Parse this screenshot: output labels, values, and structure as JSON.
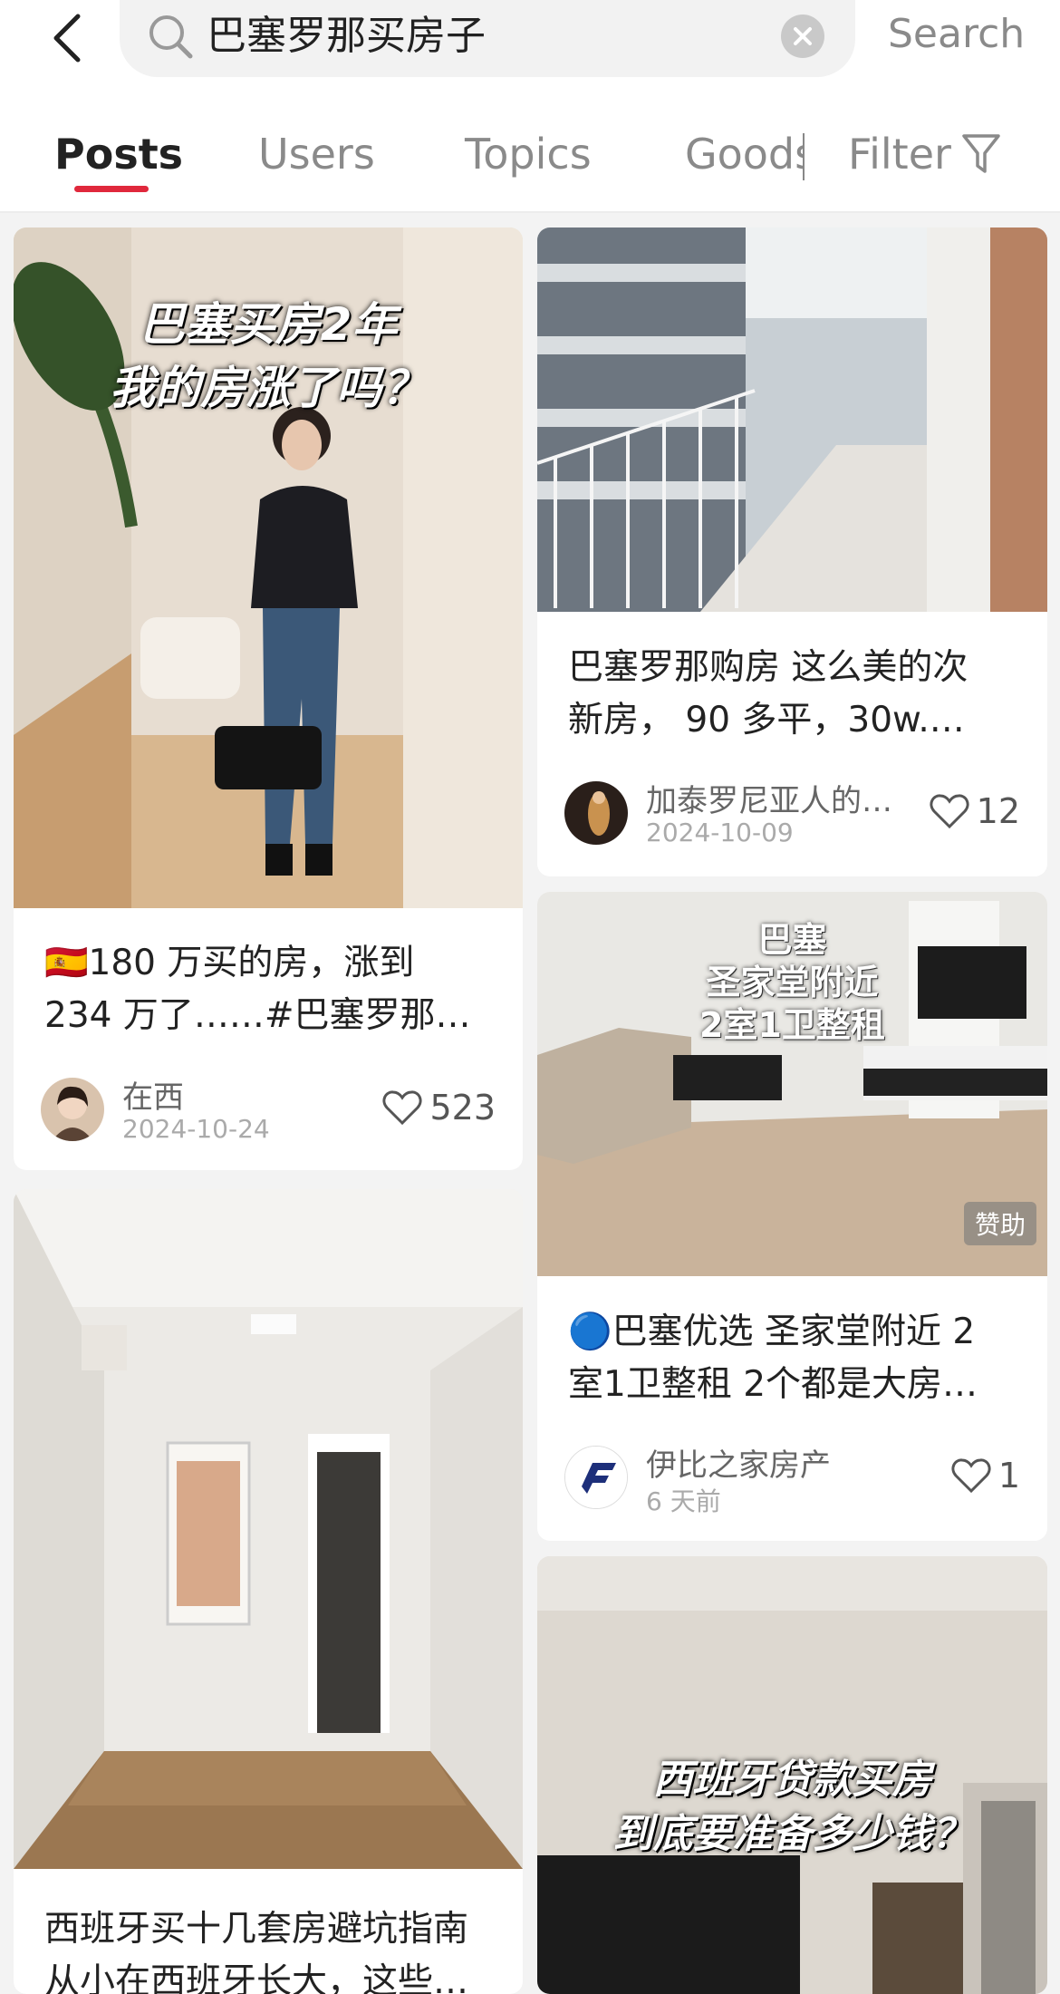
{
  "search": {
    "query": "巴塞罗那买房子",
    "button_label": "Search"
  },
  "tabs": [
    {
      "label": "Posts",
      "active": true
    },
    {
      "label": "Users",
      "active": false
    },
    {
      "label": "Topics",
      "active": false
    },
    {
      "label": "Goods",
      "active": false
    }
  ],
  "filter": {
    "label": "Filter",
    "icon": "funnel-icon"
  },
  "colors": {
    "accent": "#e0283c",
    "background": "#f3f3f3"
  },
  "posts": [
    {
      "overlay_line1": "巴塞买房2年",
      "overlay_line2": "我的房涨了吗？",
      "title_line1": "🇪🇸180 万买的房，涨到",
      "title_line2": "234 万了……#巴塞罗那…",
      "author": "在西",
      "date": "2024-10-24",
      "likes": "523"
    },
    {
      "title_line1": "巴塞罗那购房 这么美的次",
      "title_line2": "新房， 90 多平，30w.…",
      "author": "加泰罗尼亚人的…",
      "date": "2024-10-09",
      "likes": "12"
    },
    {
      "overlay_line1": "巴塞",
      "overlay_line2": "圣家堂附近",
      "overlay_line3": "2室1卫整租",
      "sponsor_label": "赞助",
      "title_line1": "🔵巴塞优选 圣家堂附近 2",
      "title_line2": "室1卫整租 2个都是大房…",
      "author": "伊比之家房产",
      "date": "6 天前",
      "likes": "1"
    },
    {
      "title_line1": "西班牙买十几套房避坑指南",
      "title_line2": "从小在西班牙长大，这些…"
    },
    {
      "overlay_line1": "西班牙贷款买房",
      "overlay_line2": "到底要准备多少钱？"
    }
  ]
}
